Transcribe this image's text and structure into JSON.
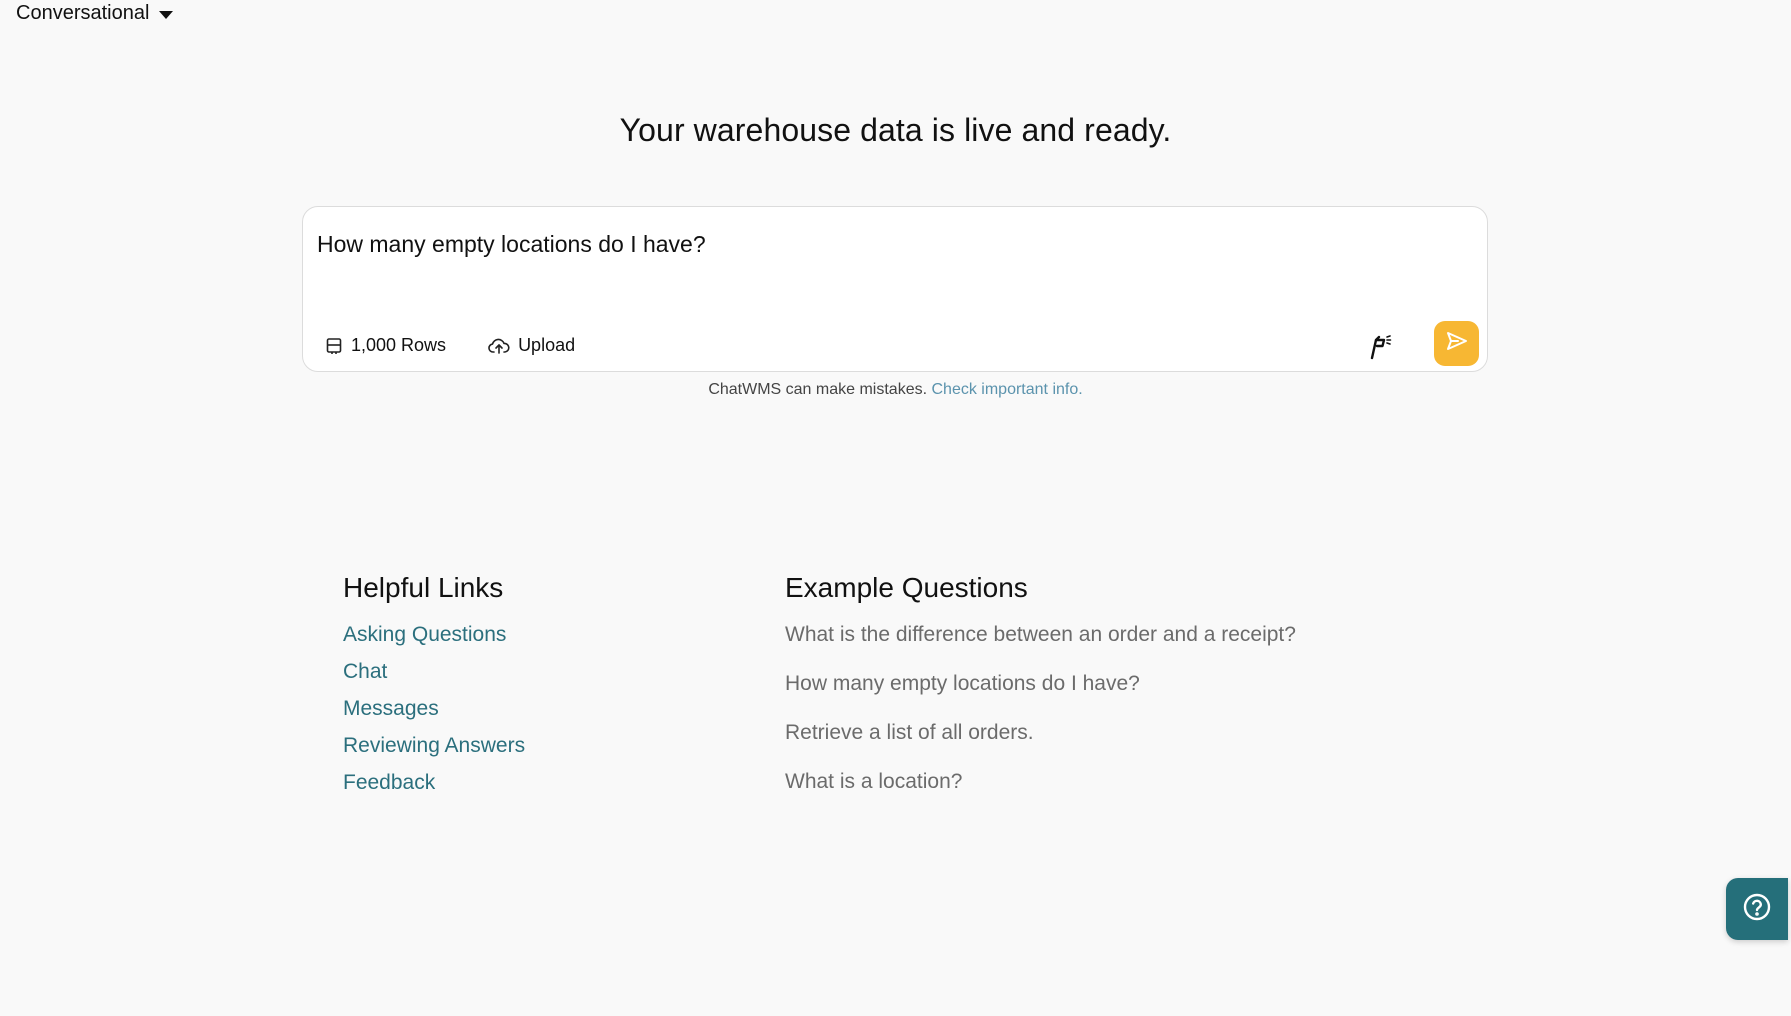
{
  "header": {
    "mode_label": "Conversational"
  },
  "hero": {
    "title": "Your warehouse data is live and ready."
  },
  "composer": {
    "input_value": "How many empty locations do I have?",
    "rows_label": "1,000 Rows",
    "upload_label": "Upload",
    "send_color": "#f7b733"
  },
  "disclaimer": {
    "text": "ChatWMS can make mistakes.",
    "link": "Check important info."
  },
  "helpful_links": {
    "title": "Helpful Links",
    "items": [
      "Asking Questions",
      "Chat",
      "Messages",
      "Reviewing Answers",
      "Feedback"
    ]
  },
  "example_questions": {
    "title": "Example Questions",
    "items": [
      "What is the difference between an order and a receipt?",
      "How many empty locations do I have?",
      "Retrieve a list of all orders.",
      "What is a location?"
    ]
  },
  "icons": {
    "mode": "chevron-down-icon",
    "rows": "table-icon",
    "upload": "cloud-upload-icon",
    "voice": "voice-icon",
    "send": "send-icon",
    "help": "help-icon"
  },
  "colors": {
    "link": "#2b6f7d",
    "disclaimer_link": "#5b93ad",
    "help_fab": "#256f7a"
  }
}
